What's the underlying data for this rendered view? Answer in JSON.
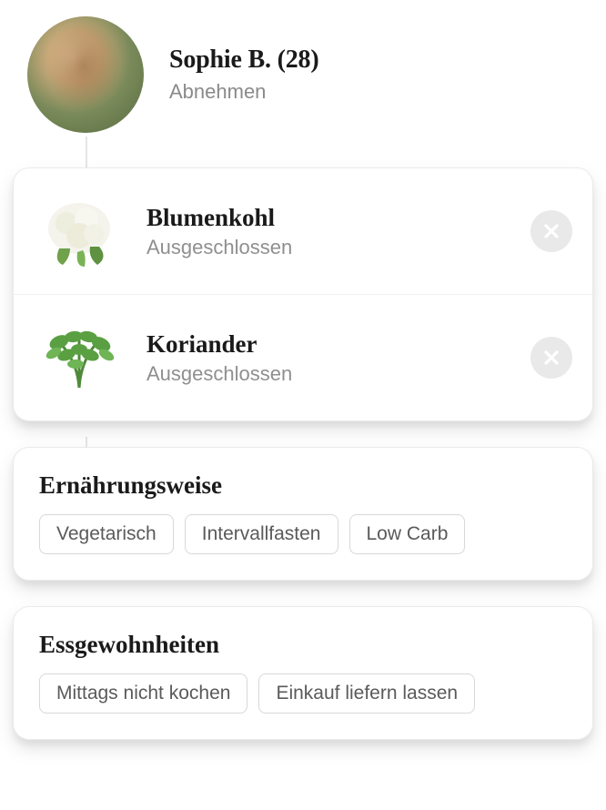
{
  "profile": {
    "name": "Sophie B. (28)",
    "goal": "Abnehmen"
  },
  "excluded": [
    {
      "name": "Blumenkohl",
      "status": "Ausgeschlossen",
      "icon": "cauliflower-icon"
    },
    {
      "name": "Koriander",
      "status": "Ausgeschlossen",
      "icon": "coriander-icon"
    }
  ],
  "diet": {
    "title": "Ernährungsweise",
    "tags": [
      "Vegetarisch",
      "Intervallfasten",
      "Low Carb"
    ]
  },
  "habits": {
    "title": "Essgewohnheiten",
    "tags": [
      "Mittags nicht kochen",
      "Einkauf liefern lassen"
    ]
  }
}
